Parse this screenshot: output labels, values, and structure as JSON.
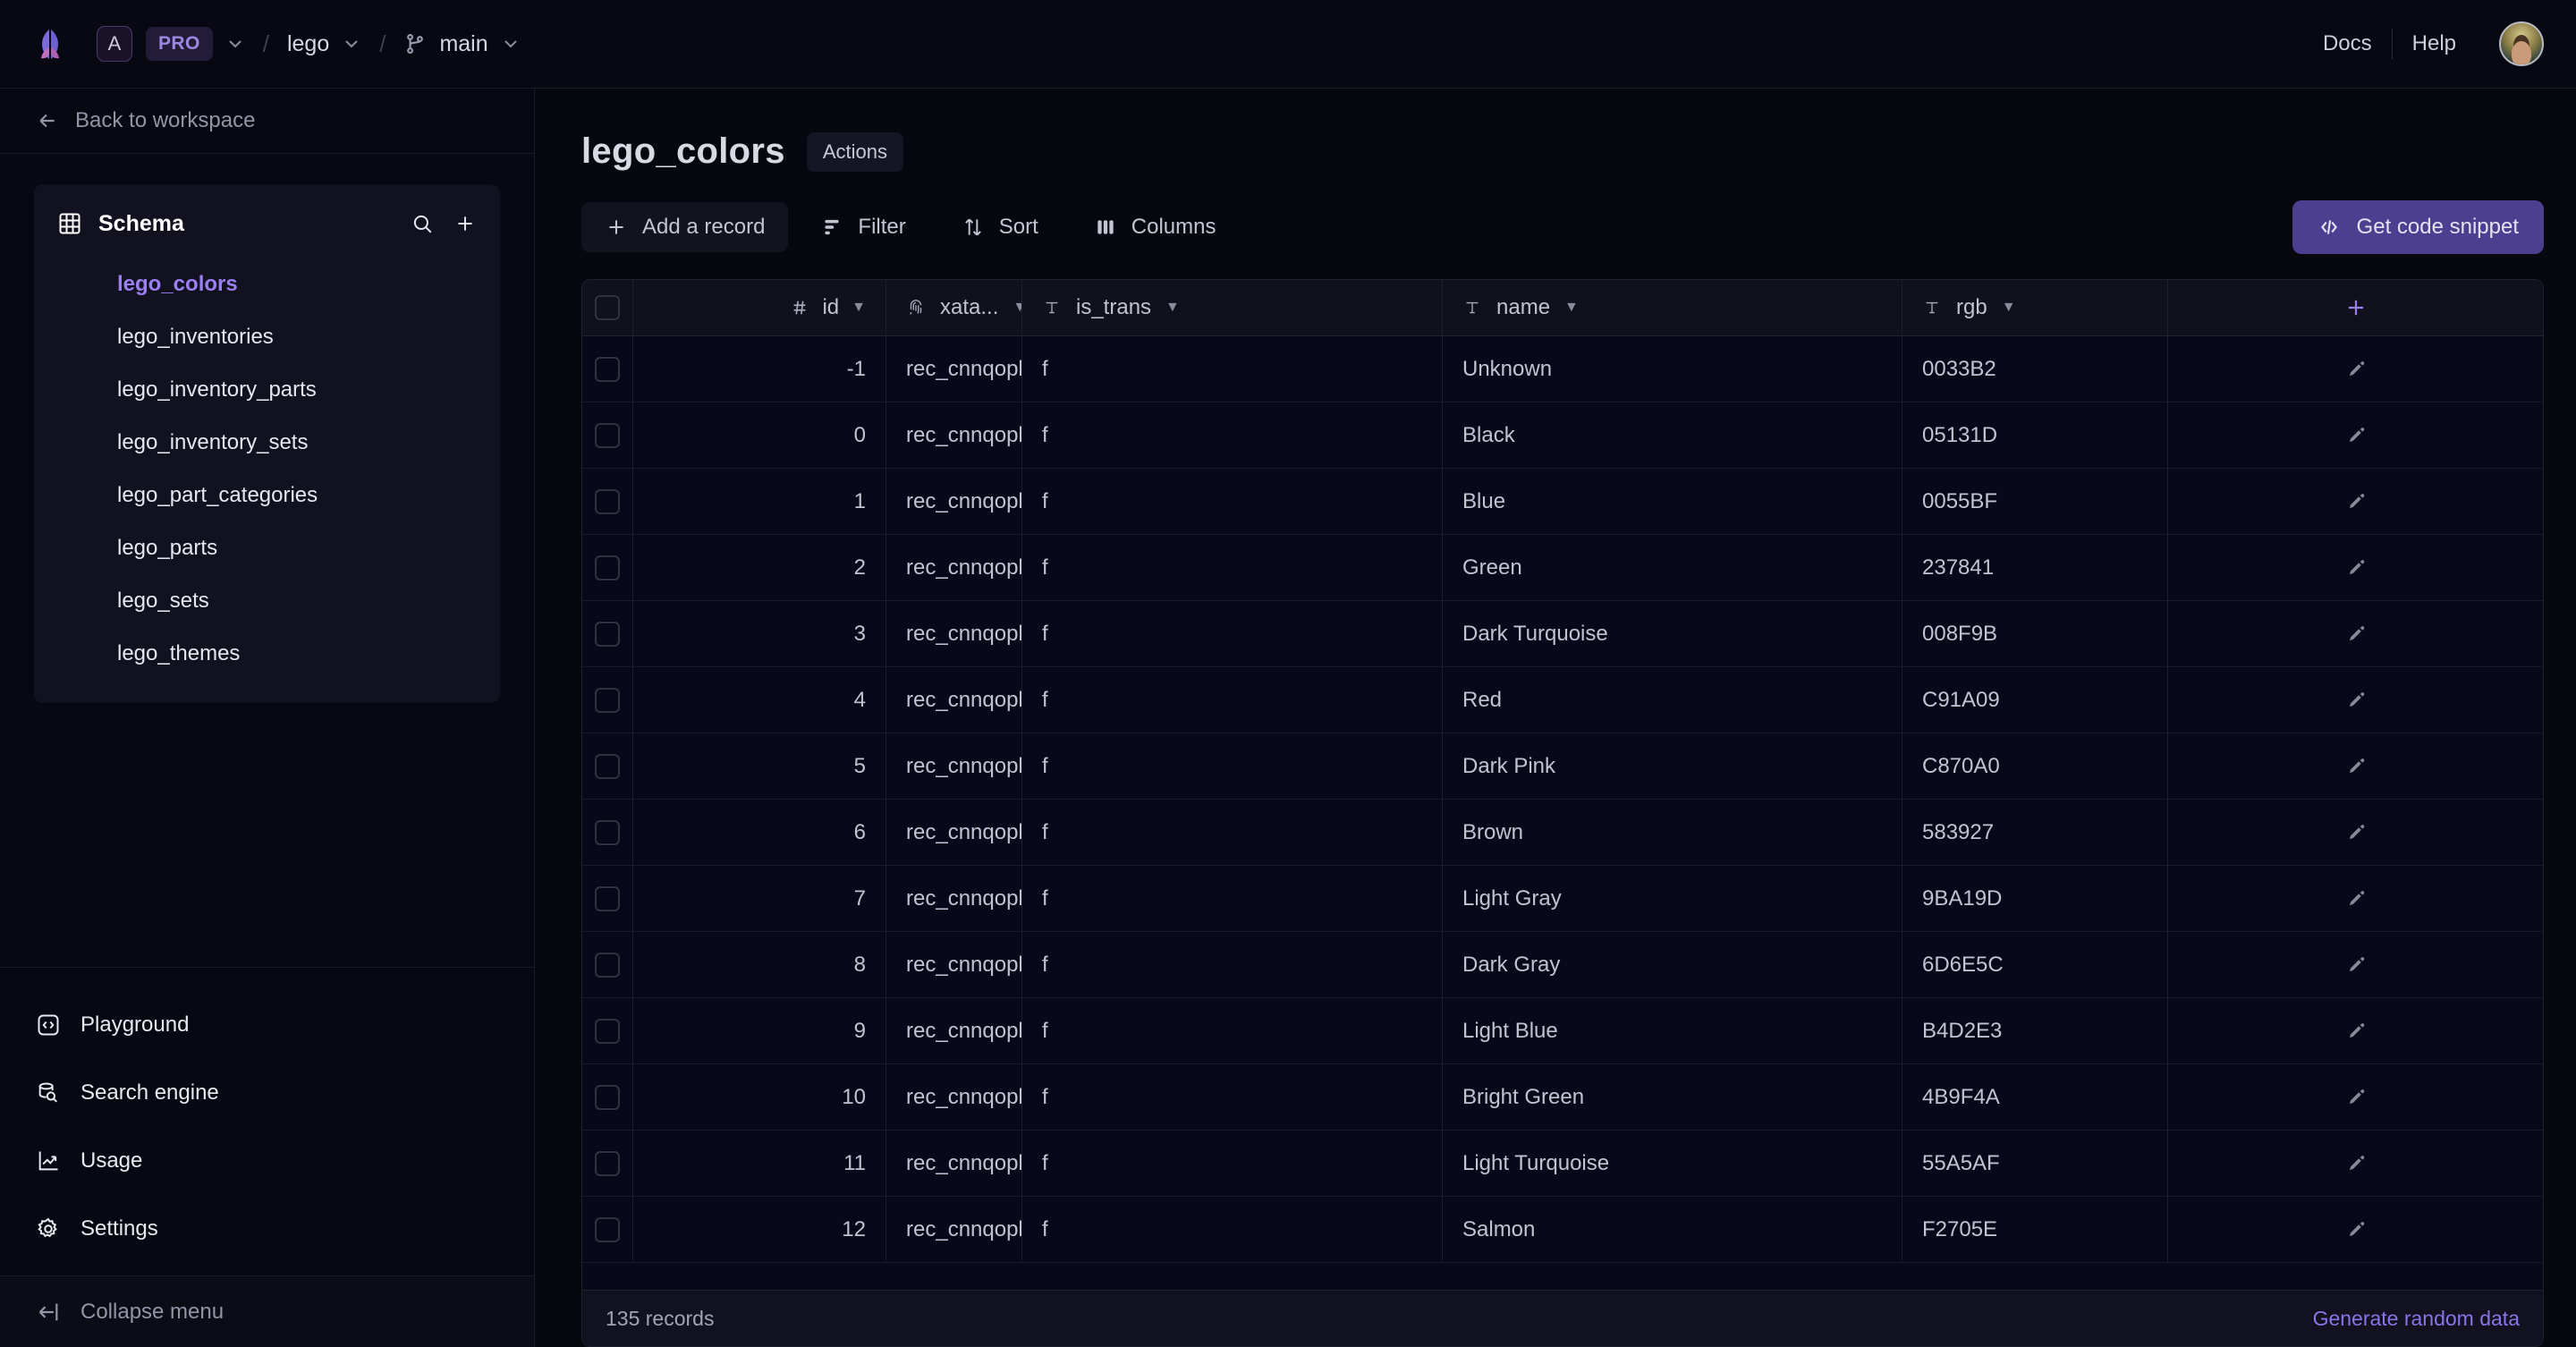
{
  "topbar": {
    "logo_icon": "xata-butterfly-logo",
    "workspace_badge": "A",
    "plan_badge": "PRO",
    "workspace_chevron_icon": "chevron-down-icon",
    "separator": "/",
    "database": "lego",
    "database_chevron_icon": "chevron-down-icon",
    "branch_icon": "git-branch-icon",
    "branch": "main",
    "branch_chevron_icon": "chevron-down-icon",
    "docs": "Docs",
    "help": "Help",
    "avatar_alt": "user-avatar"
  },
  "sidebar": {
    "back_icon": "arrow-left-icon",
    "back_label": "Back to workspace",
    "schema": {
      "icon": "table-grid-icon",
      "title": "Schema",
      "search_icon": "search-icon",
      "add_icon": "plus-icon",
      "tables": [
        {
          "label": "lego_colors",
          "active": true
        },
        {
          "label": "lego_inventories",
          "active": false
        },
        {
          "label": "lego_inventory_parts",
          "active": false
        },
        {
          "label": "lego_inventory_sets",
          "active": false
        },
        {
          "label": "lego_part_categories",
          "active": false
        },
        {
          "label": "lego_parts",
          "active": false
        },
        {
          "label": "lego_sets",
          "active": false
        },
        {
          "label": "lego_themes",
          "active": false
        }
      ]
    },
    "nav": [
      {
        "label": "Playground",
        "icon": "code-brackets-icon"
      },
      {
        "label": "Search engine",
        "icon": "database-search-icon"
      },
      {
        "label": "Usage",
        "icon": "trending-chart-icon"
      },
      {
        "label": "Settings",
        "icon": "gear-icon"
      }
    ],
    "collapse": {
      "label": "Collapse menu",
      "icon": "collapse-left-icon"
    }
  },
  "main": {
    "page_title": "lego_colors",
    "actions_label": "Actions",
    "toolbar": {
      "add_record": {
        "label": "Add a record",
        "icon": "plus-icon"
      },
      "filter": {
        "label": "Filter",
        "icon": "funnel-icon"
      },
      "sort": {
        "label": "Sort",
        "icon": "sort-arrows-icon"
      },
      "columns": {
        "label": "Columns",
        "icon": "columns-icon"
      },
      "get_snippet": {
        "label": "Get code snippet",
        "icon": "code-slash-icon"
      }
    },
    "table": {
      "columns": [
        {
          "key": "id",
          "label": "id",
          "type_icon": "hash-icon",
          "caret": "▼"
        },
        {
          "key": "xata",
          "label": "xata...",
          "type_icon": "fingerprint-icon",
          "caret": "▼"
        },
        {
          "key": "is_trans",
          "label": "is_trans",
          "type_icon": "text-type-icon",
          "caret": "▼"
        },
        {
          "key": "name",
          "label": "name",
          "type_icon": "text-type-icon",
          "caret": "▼"
        },
        {
          "key": "rgb",
          "label": "rgb",
          "type_icon": "text-type-icon",
          "caret": "▼"
        }
      ],
      "add_column_icon": "plus-icon",
      "row_edit_icon": "pencil-icon",
      "rows": [
        {
          "id": "-1",
          "xata": "rec_cnnqopl...",
          "is_trans": "f",
          "name": "Unknown",
          "rgb": "0033B2"
        },
        {
          "id": "0",
          "xata": "rec_cnnqopl...",
          "is_trans": "f",
          "name": "Black",
          "rgb": "05131D"
        },
        {
          "id": "1",
          "xata": "rec_cnnqopl...",
          "is_trans": "f",
          "name": "Blue",
          "rgb": "0055BF"
        },
        {
          "id": "2",
          "xata": "rec_cnnqopl...",
          "is_trans": "f",
          "name": "Green",
          "rgb": "237841"
        },
        {
          "id": "3",
          "xata": "rec_cnnqopl...",
          "is_trans": "f",
          "name": "Dark Turquoise",
          "rgb": "008F9B"
        },
        {
          "id": "4",
          "xata": "rec_cnnqopl...",
          "is_trans": "f",
          "name": "Red",
          "rgb": "C91A09"
        },
        {
          "id": "5",
          "xata": "rec_cnnqopl...",
          "is_trans": "f",
          "name": "Dark Pink",
          "rgb": "C870A0"
        },
        {
          "id": "6",
          "xata": "rec_cnnqopl...",
          "is_trans": "f",
          "name": "Brown",
          "rgb": "583927"
        },
        {
          "id": "7",
          "xata": "rec_cnnqopl...",
          "is_trans": "f",
          "name": "Light Gray",
          "rgb": "9BA19D"
        },
        {
          "id": "8",
          "xata": "rec_cnnqopl...",
          "is_trans": "f",
          "name": "Dark Gray",
          "rgb": "6D6E5C"
        },
        {
          "id": "9",
          "xata": "rec_cnnqopl...",
          "is_trans": "f",
          "name": "Light Blue",
          "rgb": "B4D2E3"
        },
        {
          "id": "10",
          "xata": "rec_cnnqopl...",
          "is_trans": "f",
          "name": "Bright Green",
          "rgb": "4B9F4A"
        },
        {
          "id": "11",
          "xata": "rec_cnnqopl...",
          "is_trans": "f",
          "name": "Light Turquoise",
          "rgb": "55A5AF"
        },
        {
          "id": "12",
          "xata": "rec_cnnqopl...",
          "is_trans": "f",
          "name": "Salmon",
          "rgb": "F2705E"
        }
      ],
      "footer": {
        "record_count": "135 records",
        "generate_link": "Generate random data"
      }
    }
  },
  "colors": {
    "accent_purple": "#9b7ff0",
    "button_purple": "#4d3f8f",
    "page_bg": "#070710",
    "panel_bg": "#11111f"
  }
}
